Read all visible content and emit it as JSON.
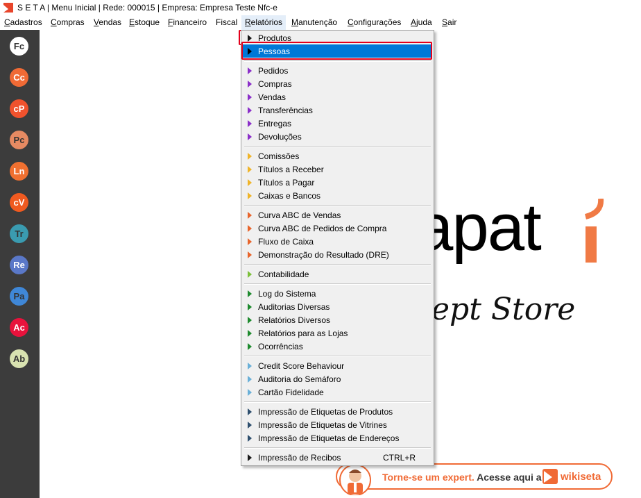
{
  "window": {
    "title": "S E T A | Menu Inicial | Rede: 000015 | Empresa: Empresa Teste Nfc-e"
  },
  "menubar": {
    "items": [
      {
        "label": "Cadastros"
      },
      {
        "label": "Compras"
      },
      {
        "label": "Vendas"
      },
      {
        "label": "Estoque"
      },
      {
        "label": "Financeiro"
      },
      {
        "label": "Fiscal"
      },
      {
        "label": "Relatórios"
      },
      {
        "label": "Manutenção"
      },
      {
        "label": "Configurações"
      },
      {
        "label": "Ajuda"
      },
      {
        "label": "Sair"
      }
    ]
  },
  "sidebar": {
    "buttons": [
      {
        "label": "Fc",
        "color": "#ffffff",
        "text_color": "#333333"
      },
      {
        "label": "Cc",
        "color": "#f06a35",
        "text_color": "#ffffff"
      },
      {
        "label": "cP",
        "color": "#f0522d",
        "text_color": "#ffffff"
      },
      {
        "label": "Pc",
        "color": "#e68a62",
        "text_color": "#333333"
      },
      {
        "label": "Ln",
        "color": "#f07030",
        "text_color": "#ffffff"
      },
      {
        "label": "cV",
        "color": "#f05a20",
        "text_color": "#ffffff"
      },
      {
        "label": "Tr",
        "color": "#3a9bb0",
        "text_color": "#333333"
      },
      {
        "label": "Re",
        "color": "#5a78c8",
        "text_color": "#ffffff"
      },
      {
        "label": "Pa",
        "color": "#3f87d7",
        "text_color": "#333333"
      },
      {
        "label": "Ac",
        "color": "#e8123c",
        "text_color": "#ffffff"
      },
      {
        "label": "Ab",
        "color": "#d8e2b0",
        "text_color": "#333333"
      }
    ]
  },
  "dropdown": {
    "items": [
      {
        "label": "Produtos",
        "arrow_color": "#1a1a1a"
      },
      {
        "label": "Pessoas",
        "arrow_color": "#1a1a1a",
        "selected": true
      },
      {
        "label": "Pedidos",
        "arrow_color": "#8b2fc9"
      },
      {
        "label": "Compras",
        "arrow_color": "#8b2fc9"
      },
      {
        "label": "Vendas",
        "arrow_color": "#8b2fc9"
      },
      {
        "label": "Transferências",
        "arrow_color": "#8b2fc9"
      },
      {
        "label": "Entregas",
        "arrow_color": "#8b2fc9"
      },
      {
        "label": "Devoluções",
        "arrow_color": "#8b2fc9"
      },
      {
        "label": "Comissões",
        "arrow_color": "#f0b429"
      },
      {
        "label": "Títulos a Receber",
        "arrow_color": "#f0b429"
      },
      {
        "label": "Títulos a Pagar",
        "arrow_color": "#f0b429"
      },
      {
        "label": "Caixas e Bancos",
        "arrow_color": "#f0b429"
      },
      {
        "label": "Curva ABC de Vendas",
        "arrow_color": "#e8652b"
      },
      {
        "label": "Curva ABC de Pedidos de Compra",
        "arrow_color": "#e8652b"
      },
      {
        "label": "Fluxo de Caixa",
        "arrow_color": "#e8652b"
      },
      {
        "label": "Demonstração do Resultado (DRE)",
        "arrow_color": "#e8652b"
      },
      {
        "label": "Contabilidade",
        "arrow_color": "#7cc03a"
      },
      {
        "label": "Log do Sistema",
        "arrow_color": "#1e8a2e"
      },
      {
        "label": "Auditorias Diversas",
        "arrow_color": "#1e8a2e"
      },
      {
        "label": "Relatórios Diversos",
        "arrow_color": "#1e8a2e"
      },
      {
        "label": "Relatórios para as Lojas",
        "arrow_color": "#1e8a2e"
      },
      {
        "label": "Ocorrências",
        "arrow_color": "#1e8a2e"
      },
      {
        "label": "Credit Score Behaviour",
        "arrow_color": "#6ab0d8"
      },
      {
        "label": "Auditoria do Semáforo",
        "arrow_color": "#6ab0d8"
      },
      {
        "label": "Cartão Fidelidade",
        "arrow_color": "#6ab0d8"
      },
      {
        "label": "Impressão de Etiquetas de Produtos",
        "arrow_color": "#2e4f6e"
      },
      {
        "label": "Impressão de Etiquetas de Vitrines",
        "arrow_color": "#2e4f6e"
      },
      {
        "label": "Impressão de Etiquetas de Endereços",
        "arrow_color": "#2e4f6e"
      },
      {
        "label": "Impressão de Recibos",
        "arrow_color": "#1a1a1a",
        "shortcut": "CTRL+R"
      }
    ]
  },
  "brand": {
    "text": "apat",
    "tagline": "ept Store",
    "accent": "#f07a45"
  },
  "wiki_banner": {
    "cta_orange": "Torne-se um expert.",
    "cta_dark": "Acesse aqui a",
    "logo_text": "wikiseta",
    "accent": "#f06a35"
  }
}
